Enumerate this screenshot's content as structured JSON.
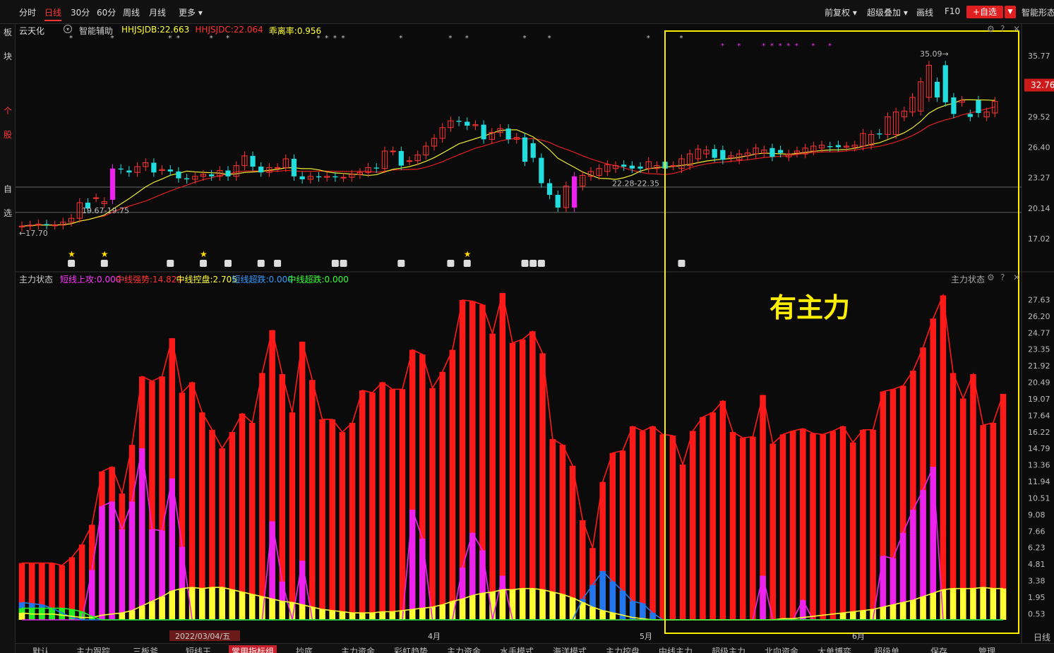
{
  "toolbar": {
    "tabs": [
      "分时",
      "日线",
      "30分",
      "60分",
      "周线",
      "月线",
      "更多"
    ],
    "active": "日线",
    "adjust": "前复权",
    "overlay": "超级叠加",
    "draw": "画线",
    "f10": "F10",
    "add": "+自选",
    "smart": "智能形态"
  },
  "left_nav": [
    [
      "板",
      "块"
    ],
    [
      "个",
      "股"
    ],
    [
      "自",
      "选"
    ]
  ],
  "upper": {
    "stock": "云天化",
    "indicator": "智能辅助",
    "legend": [
      {
        "text": "HHJSJDB:22.663",
        "color": "#ffff33"
      },
      {
        "text": "HHJSJDC:22.064",
        "color": "#ff3333"
      },
      {
        "text": "乖离率:0.956",
        "color": "#ffff33"
      }
    ],
    "price_ticks": [
      "35.77",
      "32.76",
      "29.52",
      "26.40",
      "23.27",
      "20.14",
      "17.02"
    ],
    "current_price": "32.76",
    "label_low": "←17.70",
    "label_zone1": "19.67-19.75",
    "label_zone2": "22.28-22.35",
    "label_high": "35.09→"
  },
  "lower": {
    "title": "主力状态",
    "title_right": "主力状态",
    "legend": [
      {
        "text": "短线上攻:0.000",
        "color": "#ff33ff"
      },
      {
        "text": "中线强势:14.823",
        "color": "#ff3333"
      },
      {
        "text": "中线控盘:2.705",
        "color": "#ffff33"
      },
      {
        "text": "短线超跌:0.000",
        "color": "#3399ff"
      },
      {
        "text": "中线超跌:0.000",
        "color": "#33ff33"
      }
    ],
    "ticks": [
      "27.63",
      "26.20",
      "24.77",
      "23.35",
      "21.92",
      "20.49",
      "19.07",
      "17.64",
      "16.22",
      "14.79",
      "13.36",
      "11.94",
      "10.51",
      "9.08",
      "7.66",
      "6.23",
      "4.81",
      "3.38",
      "1.95",
      "0.53"
    ],
    "annotation": "有主力"
  },
  "x_axis": {
    "labels": [
      "2022/03/04/五",
      "4月",
      "5月",
      "6月"
    ],
    "period": "日线"
  },
  "bottom_tabs": [
    "默认",
    "主力跟踪",
    "三板斧",
    "短线王",
    "常用指标组",
    "抄底",
    "主力资金",
    "彩虹趋势",
    "主力资金",
    "水手模式",
    "海洋模式",
    "主力控盘",
    "中线主力",
    "超级主力",
    "北向资金",
    "大单博弈",
    "超级单",
    "保存",
    "管理"
  ],
  "bottom_active": "常用指标组",
  "chart_data": {
    "type": "bar",
    "title": "主力状态",
    "candles": {
      "open": [
        18.2,
        18.3,
        18.4,
        18.5,
        18.4,
        18.4,
        18.7,
        19.1,
        20.7,
        21.2,
        20.6,
        21.0,
        24.2,
        24.0,
        23.8,
        24.4,
        24.8,
        24.0,
        24.1,
        23.9,
        23.2,
        23.1,
        23.4,
        23.6,
        23.4,
        24.0,
        23.4,
        24.5,
        25.5,
        24.4,
        23.8,
        24.3,
        24.3,
        25.2,
        23.4,
        23.1,
        23.4,
        23.3,
        23.4,
        23.3,
        23.3,
        23.6,
        23.8,
        24.3,
        24.2,
        26.0,
        26.0,
        25.0,
        25.0,
        25.6,
        26.5,
        27.3,
        28.4,
        29.1,
        29.0,
        28.6,
        28.7,
        27.2,
        27.9,
        28.3,
        27.2,
        27.4,
        26.8,
        25.3,
        22.7,
        21.5,
        20.2,
        20.2,
        22.4,
        23.4,
        23.5,
        23.9,
        24.2,
        24.6,
        24.5,
        24.4,
        24.2,
        24.2,
        24.9,
        24.5,
        24.2,
        24.5,
        25.2,
        25.7,
        26.2,
        26.1,
        25.3,
        25.1,
        25.5,
        25.7,
        25.8,
        26.3,
        26.1,
        25.4,
        25.8,
        25.7,
        26.0,
        26.3,
        26.5,
        26.6,
        26.4,
        26.4,
        26.5,
        26.6,
        27.8,
        27.7,
        27.7,
        29.5,
        30.0,
        30.1,
        31.5,
        33.1,
        34.8,
        31.5,
        31.0,
        29.8,
        31.2,
        29.5,
        29.9,
        30.0
      ],
      "close": [
        18.3,
        18.4,
        18.5,
        18.4,
        18.4,
        18.7,
        19.1,
        20.7,
        20.1,
        21.2,
        20.8,
        24.2,
        24.1,
        23.8,
        24.4,
        24.8,
        23.8,
        24.1,
        23.9,
        23.2,
        23.1,
        23.4,
        23.6,
        23.4,
        24.0,
        23.4,
        24.5,
        25.5,
        24.4,
        23.8,
        24.3,
        24.3,
        25.2,
        23.4,
        23.1,
        23.4,
        23.3,
        23.4,
        23.3,
        23.3,
        23.6,
        23.8,
        24.3,
        24.2,
        26.0,
        26.0,
        24.5,
        25.0,
        25.6,
        26.5,
        27.3,
        28.4,
        29.1,
        29.0,
        28.6,
        28.7,
        27.2,
        27.9,
        28.3,
        27.2,
        27.4,
        24.9,
        25.3,
        22.7,
        21.5,
        20.2,
        22.4,
        23.4,
        23.5,
        23.9,
        24.2,
        24.6,
        24.5,
        24.4,
        24.2,
        24.2,
        24.9,
        24.5,
        24.2,
        24.5,
        25.2,
        25.7,
        26.2,
        26.1,
        25.3,
        25.1,
        25.5,
        25.7,
        25.8,
        26.3,
        26.1,
        25.4,
        25.8,
        25.7,
        26.0,
        26.3,
        26.5,
        26.6,
        26.4,
        26.4,
        26.5,
        26.6,
        27.8,
        27.7,
        27.7,
        29.5,
        30.0,
        30.1,
        31.5,
        33.1,
        34.8,
        31.5,
        31.0,
        29.8,
        31.2,
        29.5,
        29.9,
        30.0,
        31.1
      ]
    },
    "ylim_price": [
      16.0,
      37.0
    ],
    "series": [
      {
        "name": "中线强势",
        "color": "#ff1a1a",
        "values": [
          4.9,
          4.9,
          4.9,
          4.9,
          4.7,
          5.4,
          6.5,
          8.2,
          12.8,
          13.2,
          10.9,
          15.1,
          21.0,
          20.6,
          21.0,
          24.3,
          19.6,
          20.5,
          17.9,
          16.4,
          14.8,
          16.2,
          17.8,
          17.0,
          21.3,
          25.0,
          21.2,
          17.9,
          24.0,
          20.7,
          17.3,
          17.3,
          16.2,
          17.0,
          19.8,
          19.6,
          20.5,
          19.9,
          19.9,
          23.3,
          22.9,
          20.0,
          21.4,
          23.3,
          27.6,
          27.5,
          27.2,
          24.7,
          28.2,
          23.9,
          24.2,
          24.9,
          23.0,
          15.6,
          15.1,
          13.3,
          8.6,
          6.2,
          11.9,
          14.4,
          14.6,
          16.7,
          16.3,
          16.7,
          16.0,
          15.9,
          13.4,
          16.3,
          17.5,
          17.9,
          18.9,
          16.2,
          15.7,
          15.8,
          19.4,
          15.2,
          16.0,
          16.3,
          16.5,
          16.1,
          16.0,
          16.3,
          16.7,
          15.3,
          16.4,
          16.4,
          19.7,
          19.9,
          20.2,
          21.5,
          23.5,
          26.0,
          28.0,
          21.3,
          19.1,
          21.2,
          16.8,
          17.0,
          19.5
        ]
      },
      {
        "name": "短线上攻",
        "color": "#ee22ee",
        "values": [
          0,
          0,
          0,
          0,
          0,
          0,
          0,
          4.3,
          9.8,
          10.2,
          7.8,
          10.2,
          14.8,
          7.8,
          7.7,
          12.2,
          6.3,
          0,
          0,
          0,
          0,
          0,
          0,
          0,
          0,
          8.5,
          3.3,
          0,
          5.1,
          0,
          0,
          0,
          0,
          0,
          0,
          0,
          0,
          0,
          0,
          9.5,
          7.0,
          0,
          0,
          0,
          4.5,
          7.5,
          6.0,
          0,
          3.8,
          0,
          0,
          0,
          0,
          0,
          0,
          0,
          0,
          0,
          0,
          0,
          0,
          0,
          0,
          0,
          0,
          0,
          0,
          0,
          0,
          0,
          0,
          0,
          0,
          0,
          3.8,
          0,
          0,
          0,
          1.7,
          0,
          0,
          0,
          0,
          0,
          0,
          0,
          5.5,
          5.3,
          7.5,
          9.5,
          11.2,
          13.2,
          0,
          0,
          0,
          0,
          0,
          0,
          0
        ]
      },
      {
        "name": "中线控盘",
        "color": "#ffff33",
        "values": [
          0.6,
          0.5,
          0.5,
          0.5,
          0.4,
          0.3,
          0.2,
          0.2,
          0.4,
          0.5,
          0.6,
          0.8,
          1.2,
          1.6,
          2.0,
          2.5,
          2.7,
          2.8,
          2.7,
          2.8,
          2.8,
          2.6,
          2.4,
          2.2,
          2.0,
          1.8,
          1.6,
          1.5,
          1.3,
          1.1,
          0.9,
          0.8,
          0.7,
          0.6,
          0.6,
          0.6,
          0.7,
          0.7,
          0.8,
          0.9,
          1.0,
          1.1,
          1.3,
          1.6,
          1.8,
          2.1,
          2.3,
          2.4,
          2.6,
          2.6,
          2.7,
          2.7,
          2.6,
          2.4,
          2.2,
          1.9,
          1.5,
          1.1,
          0.8,
          0.6,
          0.4,
          0.2,
          0.1,
          0,
          0,
          0,
          0,
          0,
          0,
          0,
          0,
          0,
          0,
          0,
          0,
          0,
          0.1,
          0.1,
          0.2,
          0.3,
          0.4,
          0.5,
          0.6,
          0.7,
          0.8,
          0.9,
          1.1,
          1.3,
          1.5,
          1.7,
          2.0,
          2.3,
          2.6,
          2.7,
          2.7,
          2.7,
          2.8,
          2.7,
          2.7
        ]
      },
      {
        "name": "短线超跌",
        "color": "#2288ff",
        "values": [
          1.5,
          1.4,
          1.3,
          1.0,
          0.6,
          0.2,
          0,
          0,
          0,
          0,
          0,
          0,
          0,
          0,
          0,
          0,
          0,
          0,
          0,
          0,
          0,
          0,
          0,
          0,
          0,
          0,
          0,
          0,
          0,
          0,
          0,
          0,
          0,
          0,
          0,
          0,
          0,
          0,
          0,
          0,
          0,
          0,
          0,
          0,
          0,
          0,
          0,
          0,
          0,
          0,
          0,
          0,
          0,
          0,
          0,
          0,
          1.8,
          3.0,
          4.2,
          3.3,
          2.5,
          1.6,
          1.4,
          0.6,
          0,
          0,
          0,
          0,
          0,
          0,
          0,
          0,
          0,
          0,
          0,
          0,
          0,
          0,
          0,
          0,
          0,
          0,
          0,
          0,
          0,
          0,
          0,
          0,
          0,
          0,
          0,
          0,
          0,
          0,
          0,
          0,
          0,
          0,
          0
        ]
      },
      {
        "name": "中线超跌",
        "color": "#22ee22",
        "values": [
          1.0,
          1.0,
          1.0,
          1.0,
          1.0,
          0.9,
          0.7,
          0.3,
          0,
          0,
          0,
          0,
          0,
          0,
          0,
          0,
          0,
          0,
          0,
          0,
          0,
          0,
          0,
          0,
          0,
          0,
          0,
          0,
          0,
          0,
          0,
          0,
          0,
          0,
          0,
          0,
          0,
          0,
          0,
          0,
          0,
          0,
          0,
          0,
          0,
          0,
          0,
          0,
          0,
          0,
          0,
          0,
          0,
          0,
          0,
          0,
          0,
          0,
          0,
          0,
          0,
          0,
          0,
          0,
          0,
          0,
          0,
          0,
          0,
          0,
          0,
          0,
          0,
          0,
          0,
          0,
          0,
          0,
          0,
          0,
          0,
          0,
          0,
          0,
          0,
          0,
          0,
          0,
          0,
          0,
          0,
          0,
          0,
          0,
          0,
          0,
          0,
          0,
          0
        ]
      }
    ],
    "ylim": [
      0,
      29.0
    ]
  }
}
